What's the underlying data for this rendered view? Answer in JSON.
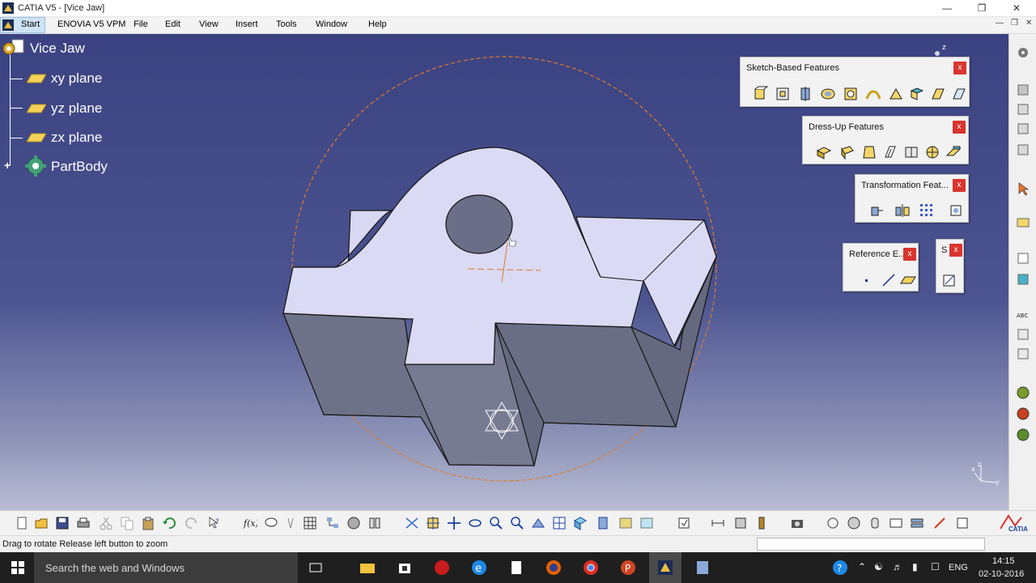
{
  "window": {
    "title": "CATIA V5 - [Vice Jaw]"
  },
  "menu": {
    "items": [
      "Start",
      "ENOVIA V5 VPM",
      "File",
      "Edit",
      "View",
      "Insert",
      "Tools",
      "Window",
      "Help"
    ]
  },
  "tree": {
    "root": "Vice Jaw",
    "items": [
      "xy plane",
      "yz plane",
      "zx plane",
      "PartBody"
    ]
  },
  "toolbars": {
    "sketch_based": "Sketch-Based Features",
    "dress_up": "Dress-Up Features",
    "transformation": "Transformation Feat...",
    "reference": "Reference E...",
    "sketcher_short": "S",
    "close_glyph": "x"
  },
  "compass": {
    "z": "z",
    "x": "x",
    "y": "y"
  },
  "status": {
    "message": "Drag to rotate  Release left button to zoom"
  },
  "taskbar": {
    "search_placeholder": "Search the web and Windows",
    "language": "ENG",
    "time": "14:15",
    "date": "02-10-2016"
  },
  "brand": {
    "catia": "CATIA"
  },
  "colors": {
    "viewport_top": "#3b4281",
    "part_face_top": "#d8d8f2",
    "part_face_side": "#6b6f86",
    "rotation_circle": "#e07a2c",
    "close_button": "#d9352e"
  }
}
